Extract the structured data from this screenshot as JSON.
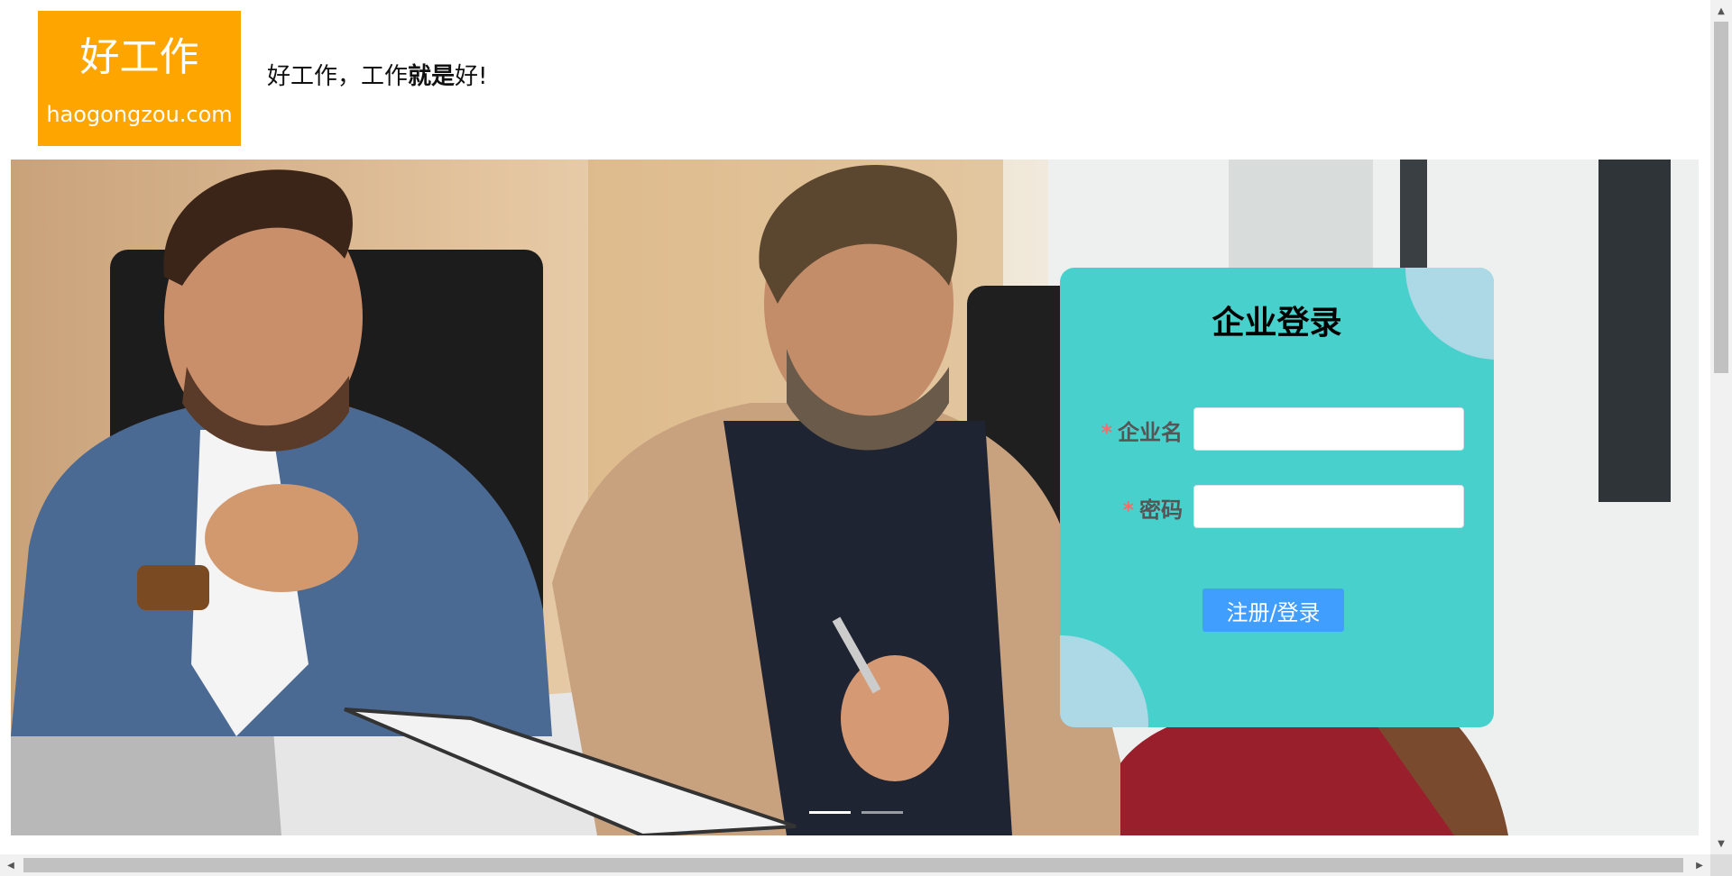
{
  "header": {
    "logo": {
      "main": "好工作",
      "domain": "haogongzou.com",
      "bg_color": "#ffa500"
    },
    "slogan": {
      "part1": "好工作，工作",
      "part2": "就是",
      "part3": "好!"
    }
  },
  "banner": {
    "carousel_indicators": [
      {
        "active": true
      },
      {
        "active": false
      }
    ]
  },
  "login_card": {
    "title": "企业登录",
    "bg_color": "#48d1cc",
    "accent_color": "#add8e6",
    "fields": [
      {
        "required_mark": "*",
        "label": "企业名",
        "value": "",
        "placeholder": ""
      },
      {
        "required_mark": "*",
        "label": "密码",
        "value": "",
        "placeholder": ""
      }
    ],
    "submit_label": "注册/登录",
    "submit_color": "#409eff"
  },
  "scrollbars": {
    "up_arrow": "▲",
    "down_arrow": "▼",
    "left_arrow": "◀",
    "right_arrow": "▶"
  }
}
